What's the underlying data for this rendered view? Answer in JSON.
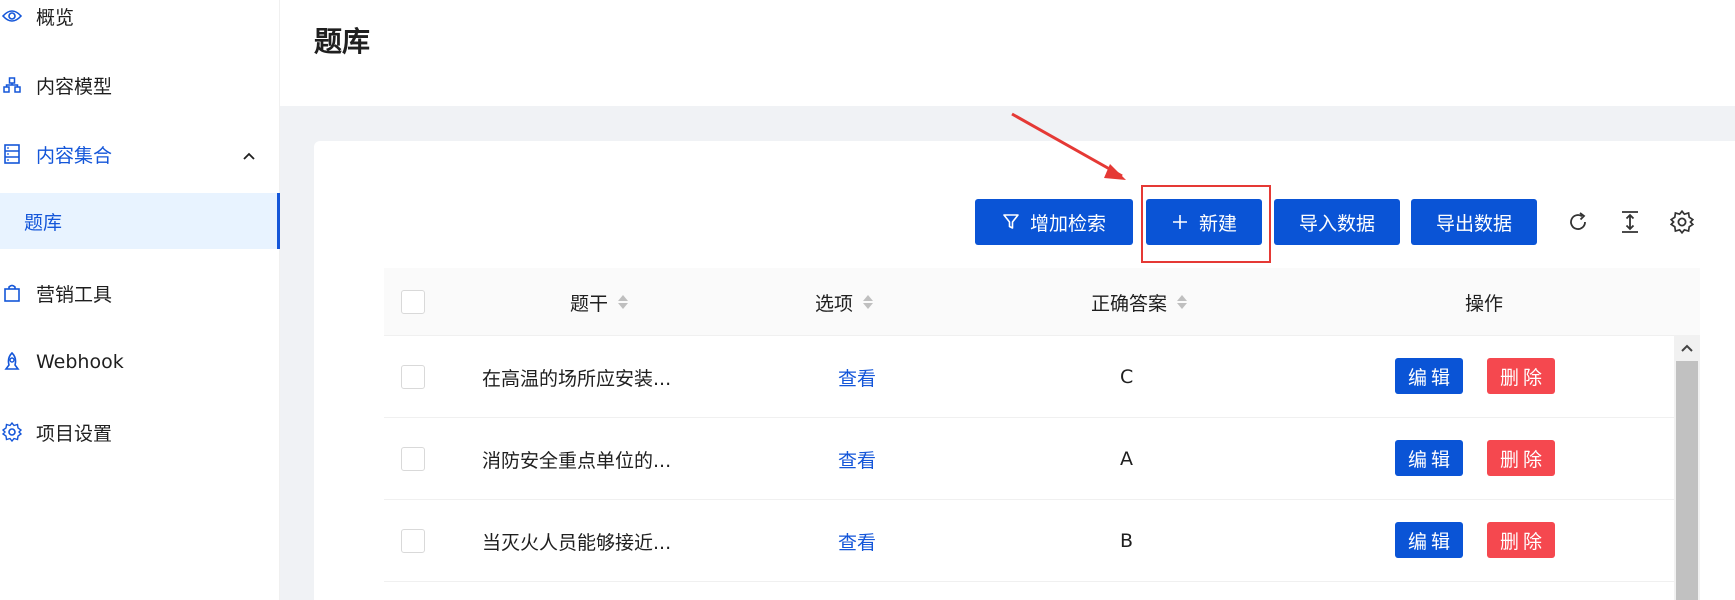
{
  "sidebar": {
    "items": [
      {
        "label": "概览",
        "icon": "eye-icon"
      },
      {
        "label": "内容模型",
        "icon": "model-icon"
      },
      {
        "label": "内容集合",
        "icon": "database-icon",
        "expanded": true
      },
      {
        "label": "题库",
        "active": true
      },
      {
        "label": "营销工具",
        "icon": "shopping-bag-icon"
      },
      {
        "label": "Webhook",
        "icon": "webhook-icon"
      },
      {
        "label": "项目设置",
        "icon": "gear-icon"
      }
    ]
  },
  "header": {
    "title": "题库"
  },
  "toolbar": {
    "add_filter_label": "增加检索",
    "new_label": "新建",
    "import_label": "导入数据",
    "export_label": "导出数据"
  },
  "table": {
    "columns": [
      "题干",
      "选项",
      "正确答案",
      "操作"
    ],
    "rows": [
      {
        "stem": "在高温的场所应安装...",
        "options": "查看",
        "answer": "C",
        "edit": "编辑",
        "delete": "删除"
      },
      {
        "stem": "消防安全重点单位的...",
        "options": "查看",
        "answer": "A",
        "edit": "编辑",
        "delete": "删除"
      },
      {
        "stem": "当灭火人员能够接近...",
        "options": "查看",
        "answer": "B",
        "edit": "编辑",
        "delete": "删除"
      }
    ]
  },
  "colors": {
    "primary": "#0a54d6",
    "danger": "#f5484f",
    "active_bg": "#e8f3ff",
    "annotation": "#e53935"
  }
}
